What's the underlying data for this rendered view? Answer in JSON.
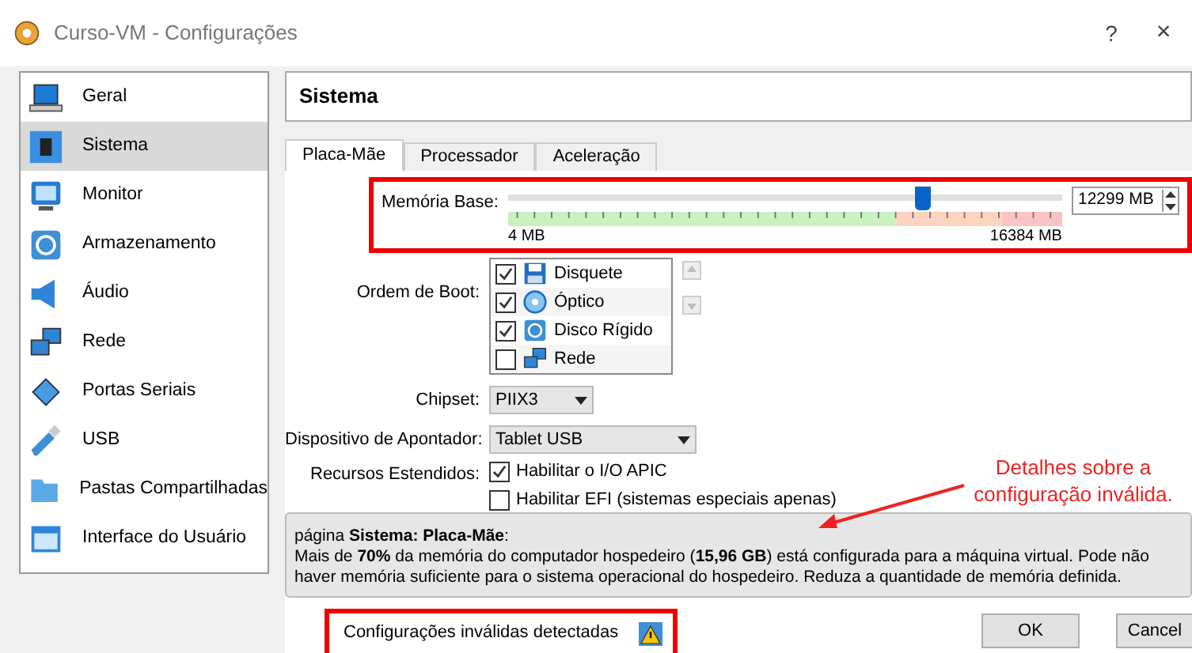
{
  "window": {
    "title": "Curso-VM - Configurações",
    "help": "?",
    "close": "×"
  },
  "sidebar": {
    "items": [
      {
        "label": "Geral",
        "kind": "laptop",
        "selected": false
      },
      {
        "label": "Sistema",
        "kind": "chip",
        "selected": true
      },
      {
        "label": "Monitor",
        "kind": "monitor",
        "selected": false
      },
      {
        "label": "Armazenamento",
        "kind": "disk",
        "selected": false
      },
      {
        "label": "Áudio",
        "kind": "speaker",
        "selected": false
      },
      {
        "label": "Rede",
        "kind": "network",
        "selected": false
      },
      {
        "label": "Portas Seriais",
        "kind": "serial",
        "selected": false
      },
      {
        "label": "USB",
        "kind": "usb",
        "selected": false
      },
      {
        "label": "Pastas Compartilhadas",
        "kind": "folder",
        "selected": false
      },
      {
        "label": "Interface do Usuário",
        "kind": "window",
        "selected": false
      }
    ]
  },
  "header": "Sistema",
  "tabs": [
    {
      "label": "Placa-Mãe",
      "selected": true
    },
    {
      "label": "Processador",
      "selected": false
    },
    {
      "label": "Aceleração",
      "selected": false
    }
  ],
  "memory": {
    "label": "Memória Base:",
    "level": 0.75,
    "value": "12299 MB",
    "min_label": "4 MB",
    "max_label": "16384 MB"
  },
  "boot": {
    "label": "Ordem de Boot:",
    "items": [
      {
        "label": "Disquete",
        "kind": "floppy",
        "checked": true
      },
      {
        "label": "Óptico",
        "kind": "cd",
        "checked": true
      },
      {
        "label": "Disco Rígido",
        "kind": "disk",
        "checked": true
      },
      {
        "label": "Rede",
        "kind": "network",
        "checked": false
      }
    ]
  },
  "chipset": {
    "label": "Chipset:",
    "value": "PIIX3"
  },
  "pointer": {
    "label": "Dispositivo de Apontador:",
    "value": "Tablet USB"
  },
  "extended": {
    "label": "Recursos Estendidos:",
    "options": [
      {
        "label": "Habilitar o I/O APIC",
        "checked": true
      },
      {
        "label": "Habilitar EFI (sistemas especiais apenas)",
        "checked": false
      }
    ]
  },
  "message": {
    "title": "página **Sistema: Placa-Mãe**:",
    "body": "Mais de **70%** da memória do computador hospedeiro (**15,96 GB**) está configurada para a máquina virtual. Pode não haver memória suficiente para o sistema operacional do hospedeiro. Reduza a quantidade de memória definida."
  },
  "annotation": "Detalhes sobre a configuração inválida.",
  "status": {
    "text": "Configurações inválidas detectadas"
  },
  "buttons": [
    "OK",
    "Cancel"
  ]
}
